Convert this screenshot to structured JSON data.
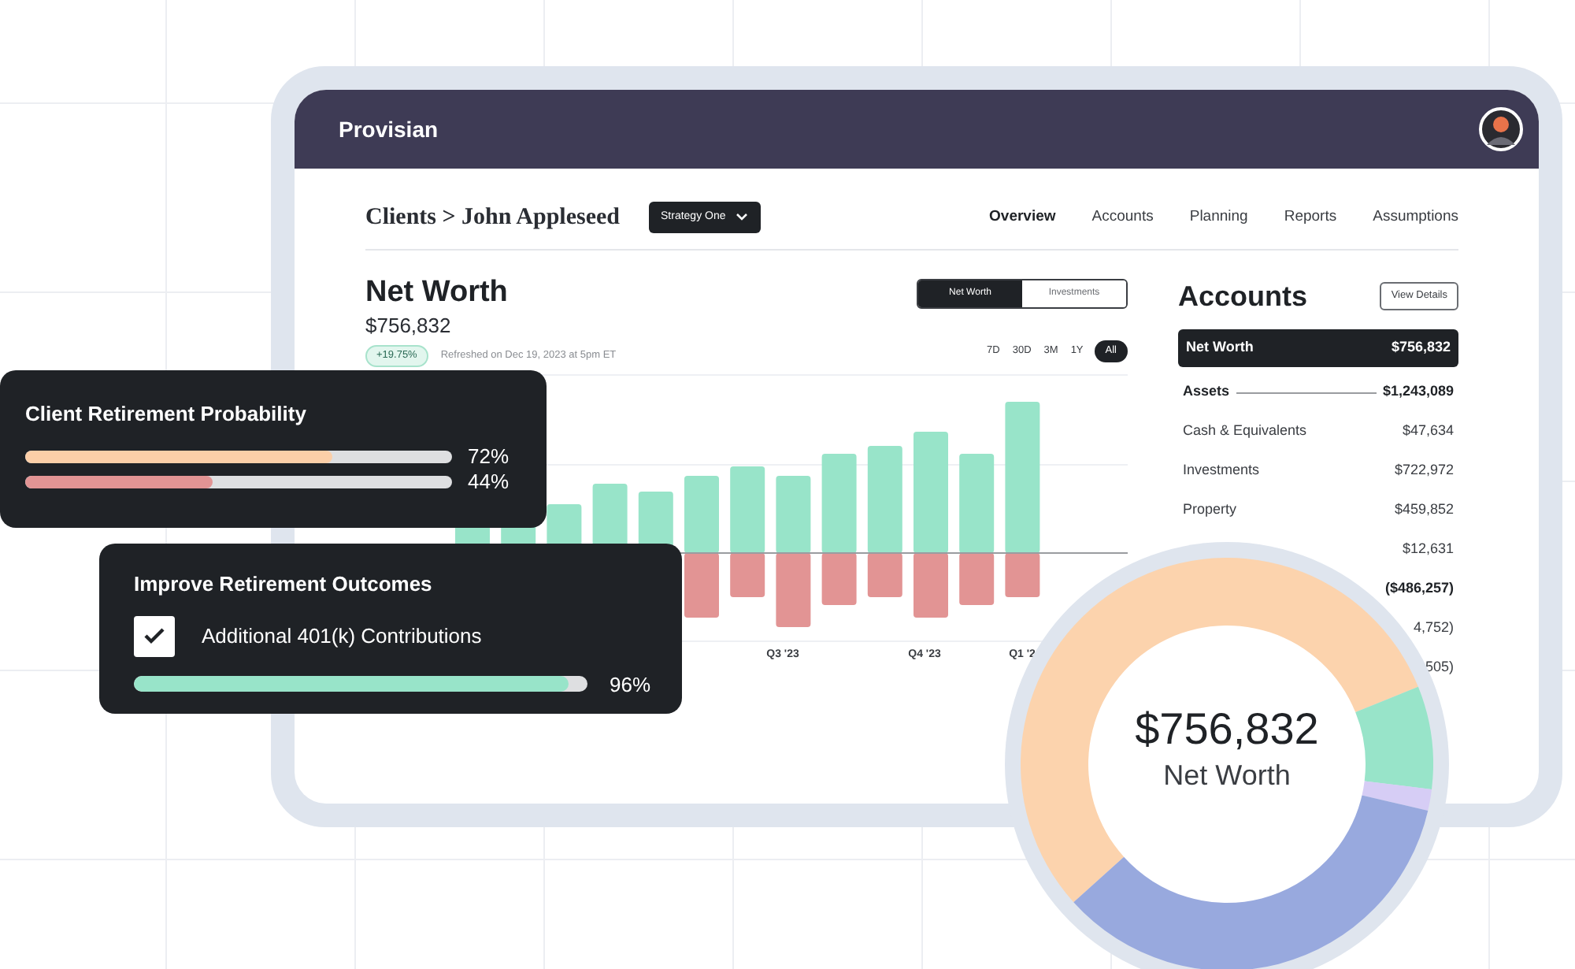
{
  "app": {
    "brand": "Provisian"
  },
  "breadcrumb": "Clients > John Appleseed",
  "strategy_dropdown": {
    "value": "Strategy One"
  },
  "nav": [
    {
      "label": "Overview",
      "selected": true
    },
    {
      "label": "Accounts",
      "selected": false
    },
    {
      "label": "Planning",
      "selected": false
    },
    {
      "label": "Reports",
      "selected": false
    },
    {
      "label": "Assumptions",
      "selected": false
    }
  ],
  "net_worth": {
    "title": "Net Worth",
    "value": "$756,832",
    "change_badge": "+19.75%",
    "refreshed": "Refreshed on Dec 19, 2023 at 5pm ET"
  },
  "view_toggle": [
    {
      "label": "Net Worth",
      "selected": true
    },
    {
      "label": "Investments",
      "selected": false
    }
  ],
  "ranges": [
    {
      "label": "7D",
      "selected": false
    },
    {
      "label": "30D",
      "selected": false
    },
    {
      "label": "3M",
      "selected": false
    },
    {
      "label": "1Y",
      "selected": false
    },
    {
      "label": "All",
      "selected": true
    }
  ],
  "chart": {
    "x_labels": [
      "Q3 '23",
      "Q4 '23",
      "Q1 '2"
    ]
  },
  "accounts": {
    "title": "Accounts",
    "button": "View Details",
    "rows": [
      {
        "kind": "total",
        "label": "Net Worth",
        "value": "$756,832"
      },
      {
        "kind": "section",
        "label": "Assets",
        "value": "$1,243,089"
      },
      {
        "kind": "item",
        "label": "Cash & Equivalents",
        "value": "$47,634"
      },
      {
        "kind": "item",
        "label": "Investments",
        "value": "$722,972"
      },
      {
        "kind": "item",
        "label": "Property",
        "value": "$459,852"
      },
      {
        "kind": "item",
        "value": "$12,631"
      },
      {
        "kind": "section",
        "value": "($486,257)"
      },
      {
        "kind": "item",
        "value": "4,752)"
      },
      {
        "kind": "item",
        "value": "505)"
      }
    ]
  },
  "probability_card": {
    "title": "Client Retirement Probability",
    "bars": [
      {
        "level": 0.72,
        "reading": "72%",
        "color": "#fccfa8"
      },
      {
        "level": 0.44,
        "reading": "44%",
        "color": "#e29494"
      }
    ]
  },
  "outcomes_card": {
    "title": "Improve Retirement Outcomes",
    "option": {
      "label": "Additional 401(k) Contributions",
      "checked": true
    },
    "level": 0.96,
    "reading": "96%"
  },
  "donut": {
    "value": "$756,832",
    "label": "Net Worth"
  }
}
